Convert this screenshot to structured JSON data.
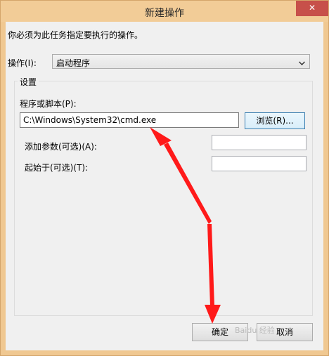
{
  "window": {
    "title": "新建操作",
    "close_glyph": "✕"
  },
  "description": "你必须为此任务指定要执行的操作。",
  "operation": {
    "label": "操作(I):",
    "value": "启动程序"
  },
  "settings": {
    "group_label": "设置",
    "program_label": "程序或脚本(P):",
    "program_value": "C:\\Windows\\System32\\cmd.exe",
    "browse_label": "浏览(R)...",
    "args_label": "添加参数(可选)(A):",
    "args_value": "",
    "start_label": "起始于(可选)(T):",
    "start_value": ""
  },
  "buttons": {
    "ok": "确定",
    "cancel": "取消"
  },
  "watermark": "Baidu 经验",
  "colors": {
    "titlebar": "#f2cc97",
    "close": "#c7504a",
    "annotation_arrow": "#ff1a1a"
  }
}
